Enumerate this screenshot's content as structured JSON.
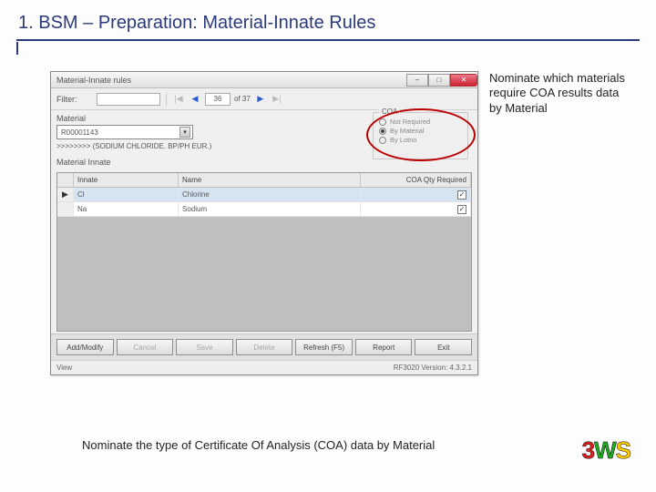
{
  "slide": {
    "title": "1. BSM – Preparation: Material-Innate Rules",
    "callout": "Nominate which materials require COA results data by Material",
    "footnote": "Nominate the type of Certificate Of Analysis (COA) data by Material",
    "logo": {
      "a": "3",
      "b": "W",
      "c": "S"
    }
  },
  "win": {
    "title": "Material-Innate rules",
    "filter_label": "Filter:",
    "filter_value": "",
    "record": {
      "pos": "36",
      "of_label": "of 37"
    },
    "material_label": "Material",
    "material_value": "R00001143",
    "material_desc": ">>>>>>>> (SODIUM CHLORIDE. BP/PH EUR.)",
    "coa": {
      "legend": "COA",
      "opts": [
        "Not Required",
        "By Material",
        "By Lotno"
      ],
      "selected": 1
    },
    "grid": {
      "section": "Material Innate",
      "headers": [
        "Innate",
        "Name",
        "COA Qty Required"
      ],
      "rows": [
        {
          "sel": "▶",
          "innate": "Cl",
          "name": "Chlorine",
          "chk": true
        },
        {
          "sel": "",
          "innate": "Na",
          "name": "Sodium",
          "chk": true
        }
      ]
    },
    "buttons": {
      "add": "Add/Modify",
      "cancel": "Cancel",
      "save": "Save",
      "delete": "Delete",
      "refresh": "Refresh (F5)",
      "report": "Report",
      "exit": "Exit"
    },
    "status": {
      "left": "View",
      "right": "RF3020 Version: 4.3.2.1"
    }
  }
}
